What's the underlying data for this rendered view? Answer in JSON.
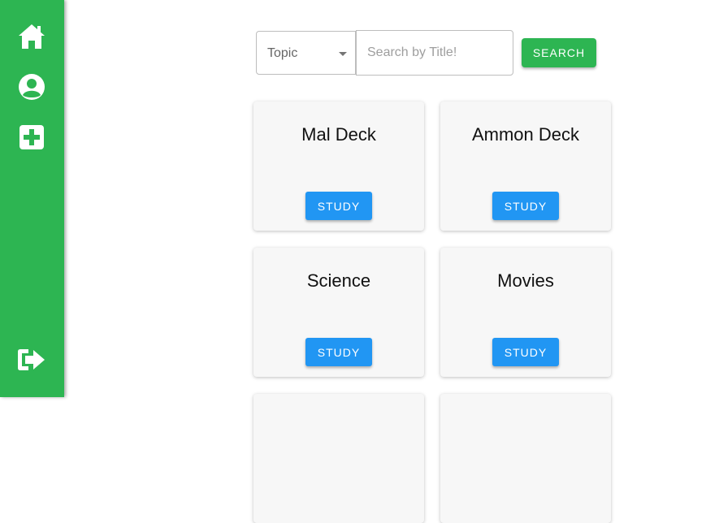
{
  "sidebar": {
    "items": [
      {
        "name": "home-icon"
      },
      {
        "name": "account-circle-icon"
      },
      {
        "name": "add-box-icon"
      },
      {
        "name": "logout-icon"
      }
    ],
    "color": "#2db552"
  },
  "toolbar": {
    "topic_label": "Topic",
    "search_placeholder": "Search by Title!",
    "search_value": "",
    "search_button_label": "SEARCH"
  },
  "decks": [
    {
      "title": "Mal Deck",
      "button_label": "STUDY"
    },
    {
      "title": "Ammon Deck",
      "button_label": "STUDY"
    },
    {
      "title": "Science",
      "button_label": "STUDY"
    },
    {
      "title": "Movies",
      "button_label": "STUDY"
    }
  ],
  "colors": {
    "accent": "#2db552",
    "study_button": "#2196f3"
  }
}
